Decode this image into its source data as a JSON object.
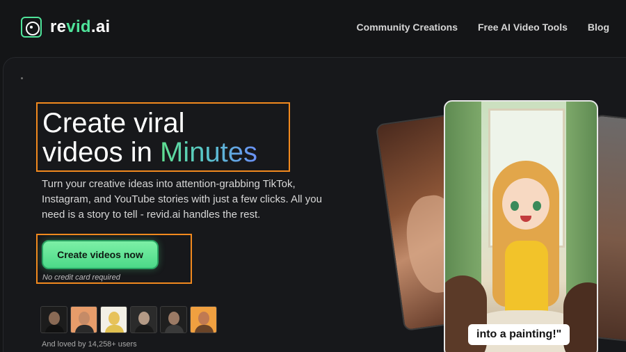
{
  "header": {
    "logo": {
      "part1": "re",
      "part2": "vid",
      "part3": ".ai"
    },
    "nav": [
      "Community Creations",
      "Free AI Video Tools",
      "Blog"
    ]
  },
  "hero": {
    "title_line1": "Create viral",
    "title_line2_prefix": "videos in ",
    "title_highlight": "Minutes",
    "subtitle": "Turn your creative ideas into attention-grabbing TikTok, Instagram, and YouTube stories with just a few clicks. All you need is a story to tell - revid.ai handles the rest.",
    "cta_label": "Create videos now",
    "cta_note": "No credit card required",
    "loved_text": "And loved by 14,258+ users"
  },
  "avatars": [
    {
      "bg": "#1c1c1c",
      "face": "#8a6a55",
      "body": "#111111"
    },
    {
      "bg": "#e79c6a",
      "face": "#c58b67",
      "body": "#2a2a2a"
    },
    {
      "bg": "#f3f0e6",
      "face": "#e7c25a",
      "body": "#e0c050"
    },
    {
      "bg": "#2b2b2b",
      "face": "#b49a86",
      "body": "#1a1a1a"
    },
    {
      "bg": "#1f1f1f",
      "face": "#9b7a65",
      "body": "#3a3a3a"
    },
    {
      "bg": "#f0a040",
      "face": "#c07a52",
      "body": "#6a4428"
    }
  ],
  "showcase": {
    "caption": "into a painting!\""
  },
  "colors": {
    "accent": "#4fe39a",
    "highlight_box": "#f2891e",
    "background": "#141517"
  }
}
